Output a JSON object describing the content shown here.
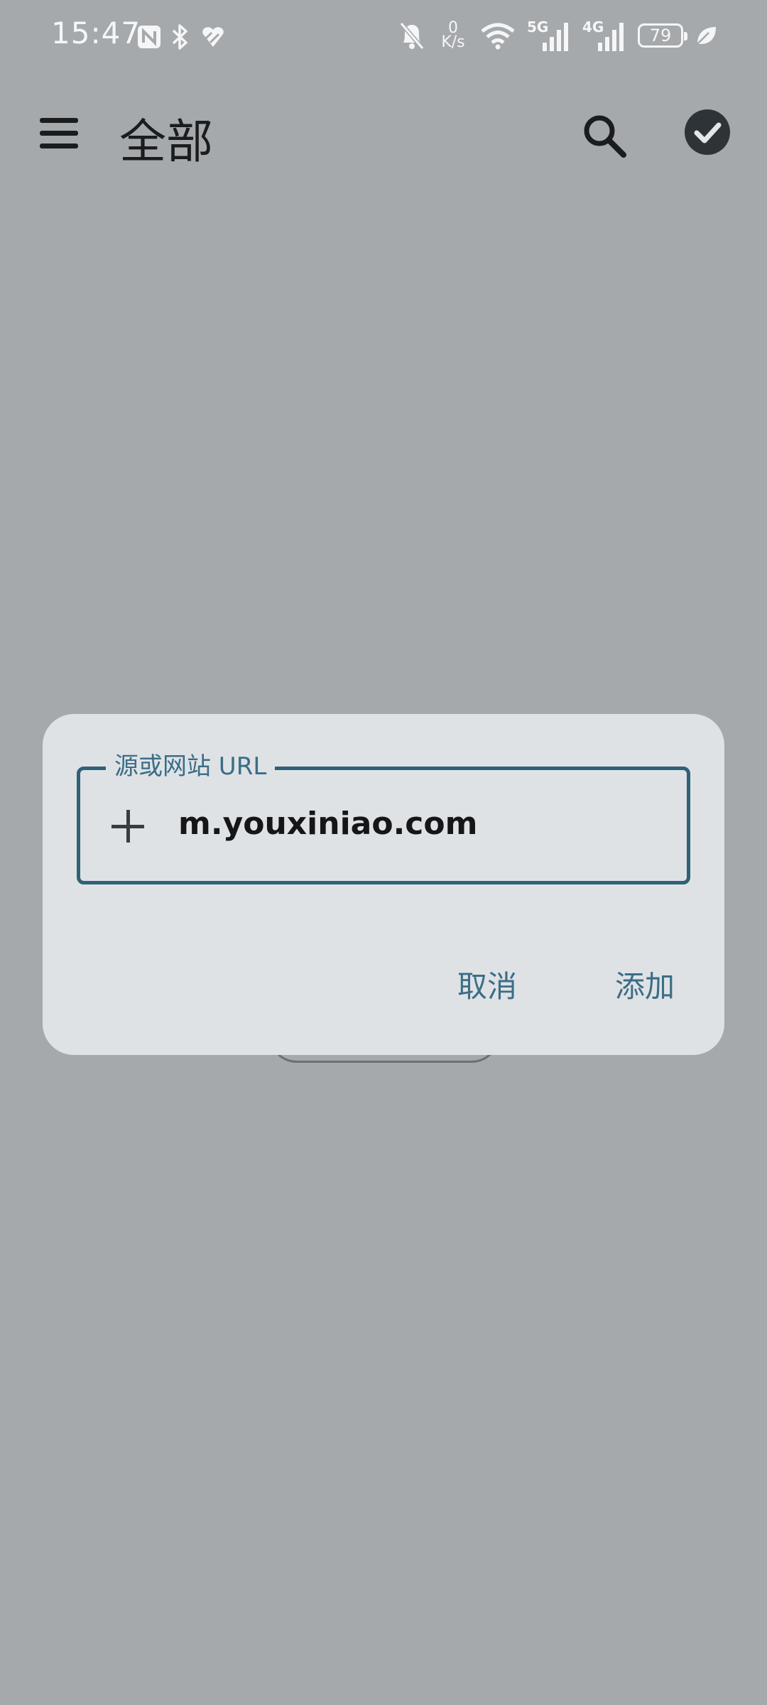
{
  "status_bar": {
    "time": "15:47",
    "net_speed_value": "0",
    "net_speed_unit": "K/s",
    "network_5g": "5G",
    "network_4g": "4G",
    "battery": "79",
    "icons": [
      "nfc-icon",
      "bluetooth-icon",
      "health-icon",
      "mute-icon",
      "wifi-icon",
      "signal-5g-icon",
      "signal-4g-icon",
      "battery-icon",
      "leaf-icon"
    ]
  },
  "app_bar": {
    "title": "全部",
    "icons": [
      "menu-icon",
      "search-icon",
      "check-icon"
    ]
  },
  "dialog": {
    "field_label": "源或网站 URL",
    "field_value": "m.youxiniao.com",
    "cancel_label": "取消",
    "add_label": "添加"
  },
  "colors": {
    "scrim_background": "#a6a9ac",
    "dialog_background": "#dfe2e5",
    "accent": "#2f6178",
    "accent_text": "#3a6e87"
  }
}
